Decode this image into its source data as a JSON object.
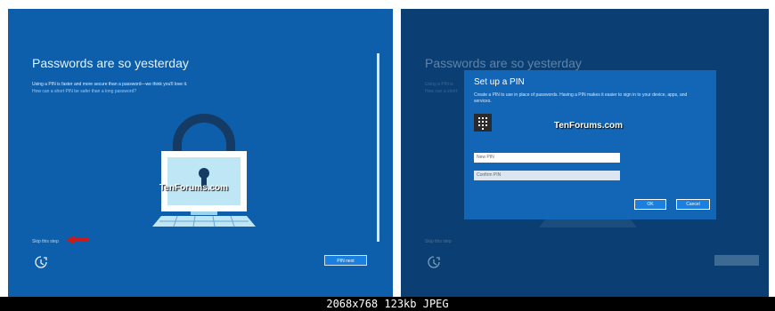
{
  "left_screen": {
    "title": "Passwords are so yesterday",
    "line1": "Using a PIN is faster and more secure than a password—we think you'll love it.",
    "line2": "How can a short PIN be safer than a long password?",
    "watermark": "TenForums.com",
    "skip_link": "Skip this step",
    "pin_next_button": "PIN next",
    "ease_of_access_icon": "ease-of-access-icon",
    "arrow_color": "#cc1a1a"
  },
  "right_screen": {
    "title": "Passwords are so yesterday",
    "line1": "Using a PIN is",
    "line2": "How can a short",
    "skip_link": "Skip this step",
    "dialog": {
      "title": "Set up a PIN",
      "description": "Create a PIN to use in place of passwords. Having a PIN makes it easier to sign in to your device, apps, and services.",
      "watermark": "TenForums.com",
      "new_pin_placeholder": "New PIN",
      "confirm_pin_placeholder": "Confirm PIN",
      "ok_button": "OK",
      "cancel_button": "Cancel",
      "keypad_icon": "keypad-icon"
    }
  },
  "footer": {
    "info": "2068x768  123kb  JPEG"
  }
}
